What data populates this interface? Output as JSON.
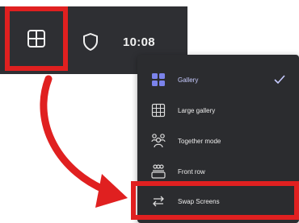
{
  "toolbar": {
    "grid_icon": "grid-layout-icon",
    "shield_icon": "shield-icon",
    "time": "10:08"
  },
  "menu": {
    "items": [
      {
        "label": "Gallery",
        "icon": "gallery-icon",
        "selected": true
      },
      {
        "label": "Large gallery",
        "icon": "large-gallery-icon",
        "selected": false
      },
      {
        "label": "Together mode",
        "icon": "together-mode-icon",
        "selected": false
      },
      {
        "label": "Front row",
        "icon": "front-row-icon",
        "selected": false
      },
      {
        "label": "Swap Screens",
        "icon": "swap-icon",
        "selected": false
      }
    ],
    "check_icon": "check-icon"
  },
  "colors": {
    "annotation_red": "#e02020",
    "toolbar_bg": "#2e2f33",
    "menu_bg": "#2b2c2f",
    "accent": "#7b83eb"
  }
}
